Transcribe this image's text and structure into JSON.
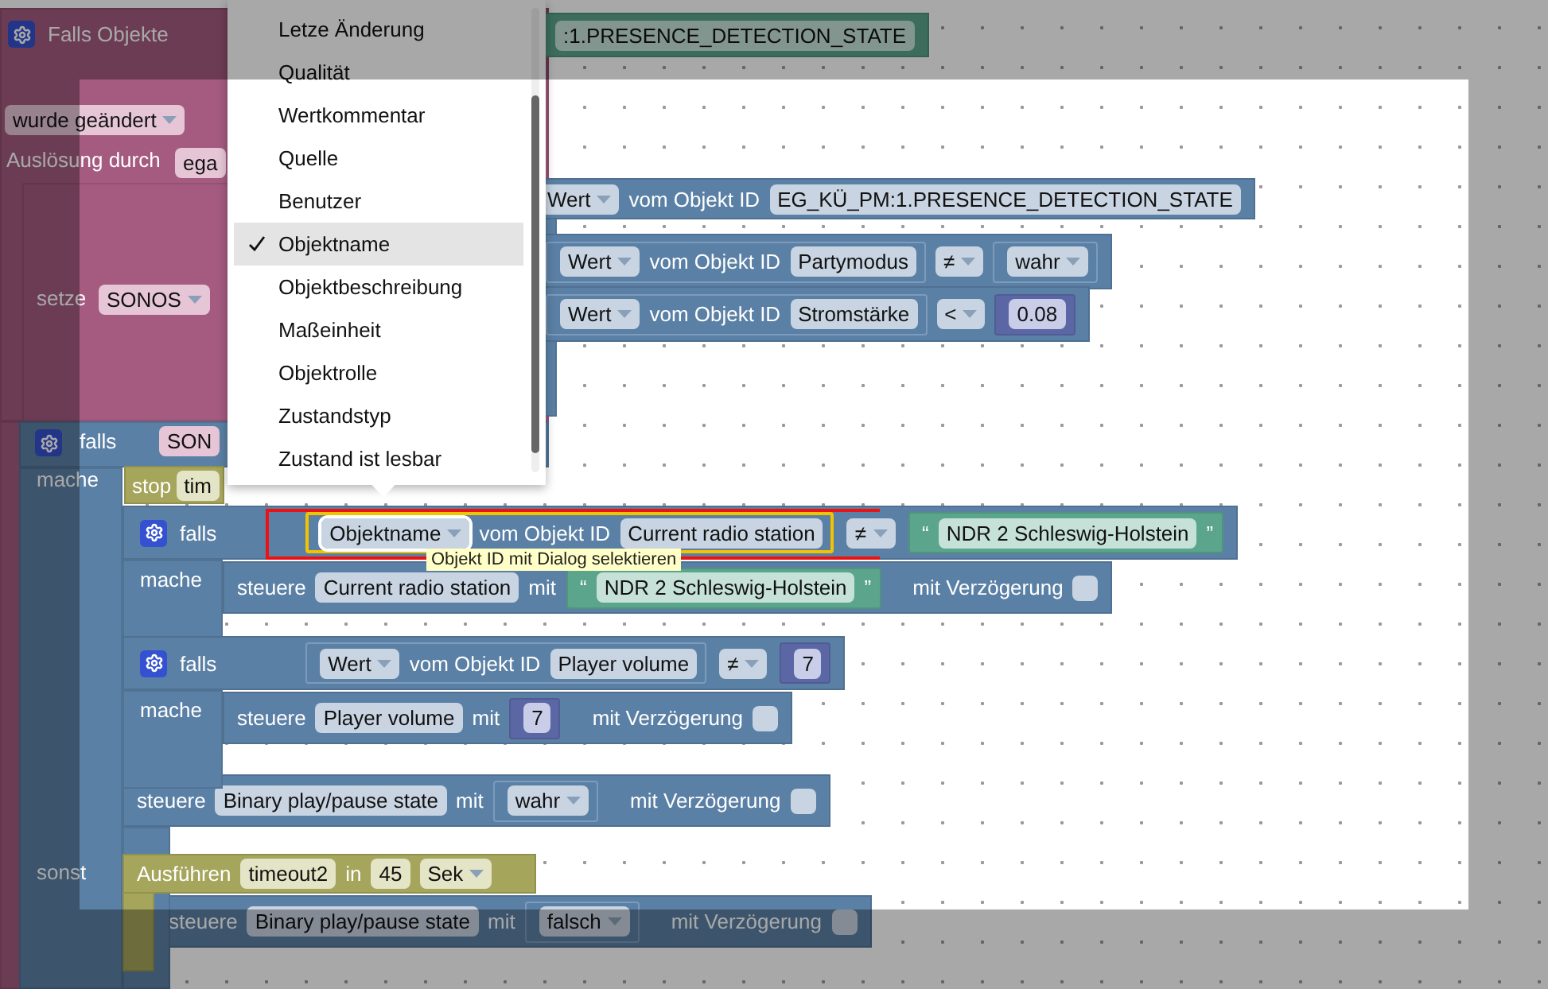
{
  "trigger": {
    "title": "Falls Objekte",
    "object_id": ":1.PRESENCE_DETECTION_STATE",
    "change": "wurde geändert",
    "trigger_label": "Auslösung durch",
    "trigger_value": "ega"
  },
  "set_block": {
    "label": "setze",
    "variable": "SONOS"
  },
  "condition_rows": [
    {
      "mode": "Wert",
      "label": "vom Objekt ID",
      "object": "EG_KÜ_PM:1.PRESENCE_DETECTION_STATE"
    },
    {
      "mode": "Wert",
      "label": "vom Objekt ID",
      "object": "Partymodus",
      "operator": "≠",
      "value": "wahr",
      "kind": "boolean"
    },
    {
      "mode": "Wert",
      "label": "vom Objekt ID",
      "object": "Stromstärke",
      "operator": "<",
      "value": "0.08",
      "kind": "number"
    }
  ],
  "outer_if": {
    "label": "falls",
    "variable": "SON",
    "do_label": "mache",
    "else_label": "sonst"
  },
  "stop": {
    "label": "stop",
    "name": "tim"
  },
  "if_blocks": [
    {
      "label": "falls",
      "mode": "Objektname",
      "id_label": "vom Objekt ID",
      "object": "Current radio station",
      "operator": "≠",
      "value": "NDR 2 Schleswig-Holstein",
      "kind": "text",
      "highlighted": true,
      "do_label": "mache",
      "action": {
        "label": "steuere",
        "object": "Current radio station",
        "with": "mit",
        "value": "NDR 2 Schleswig-Holstein",
        "kind": "text",
        "delay_label": "mit Verzögerung",
        "delay": false
      }
    },
    {
      "label": "falls",
      "mode": "Wert",
      "id_label": "vom Objekt ID",
      "object": "Player volume",
      "operator": "≠",
      "value": "7",
      "kind": "number",
      "highlighted": false,
      "do_label": "mache",
      "action": {
        "label": "steuere",
        "object": "Player volume",
        "with": "mit",
        "value": "7",
        "kind": "number",
        "delay_label": "mit Verzögerung",
        "delay": false
      }
    }
  ],
  "control": {
    "label": "steuere",
    "object": "Binary play/pause state",
    "with": "mit",
    "value": "wahr",
    "kind": "boolean",
    "delay_label": "mit Verzögerung",
    "delay": false
  },
  "timeout": {
    "label": "Ausführen",
    "name": "timeout2",
    "in": "in",
    "value": "45",
    "unit": "Sek",
    "action": {
      "label": "steuere",
      "object": "Binary play/pause state",
      "with": "mit",
      "value": "falsch",
      "kind": "boolean",
      "delay_label": "mit Verzögerung",
      "delay": false
    }
  },
  "quotes": {
    "open": "“",
    "close": "”"
  },
  "menu": {
    "items": [
      {
        "label": "Letze Änderung",
        "selected": false
      },
      {
        "label": "Qualität",
        "selected": false
      },
      {
        "label": "Wertkommentar",
        "selected": false
      },
      {
        "label": "Quelle",
        "selected": false
      },
      {
        "label": "Benutzer",
        "selected": false
      },
      {
        "label": "Objektname",
        "selected": true
      },
      {
        "label": "Objektbeschreibung",
        "selected": false
      },
      {
        "label": "Maßeinheit",
        "selected": false
      },
      {
        "label": "Objektrolle",
        "selected": false
      },
      {
        "label": "Zustandstyp",
        "selected": false
      },
      {
        "label": "Zustand ist lesbar",
        "selected": false
      }
    ]
  },
  "tooltip": "Objekt ID mit Dialog selektieren"
}
